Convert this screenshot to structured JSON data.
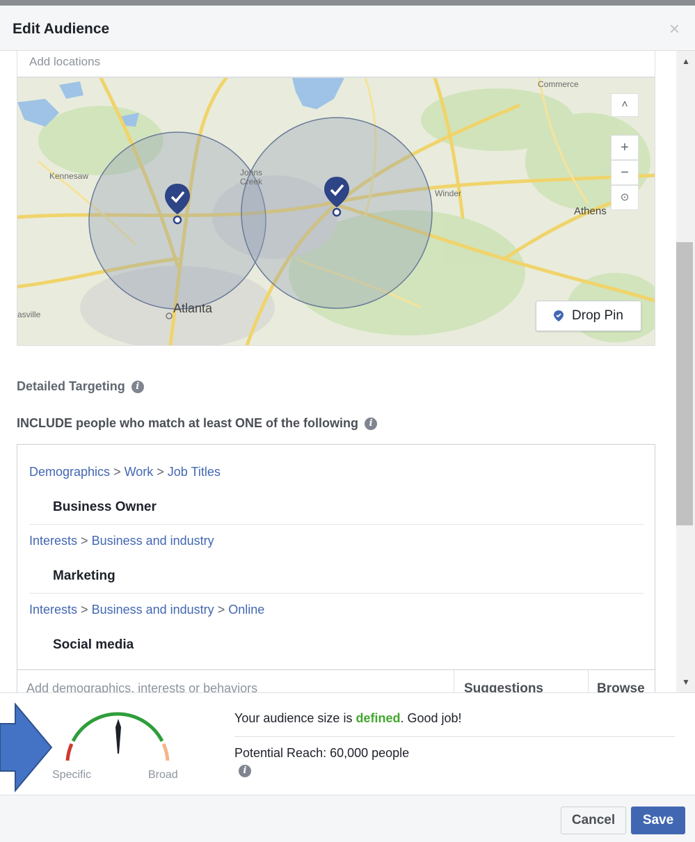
{
  "dialog": {
    "title": "Edit Audience",
    "close_icon": "×"
  },
  "locations": {
    "placeholder": "Add locations",
    "map_labels": {
      "kennesaw": "Kennesaw",
      "johns_creek_1": "Johns",
      "johns_creek_2": "Creek",
      "winder": "Winder",
      "athens": "Athens",
      "commerce": "Commerce",
      "atlanta": "Atlanta",
      "asville": "asville"
    },
    "drop_pin_label": "Drop Pin",
    "zoom_in": "+",
    "zoom_out": "−",
    "collapse": "˄"
  },
  "detailed_targeting": {
    "label": "Detailed Targeting",
    "include_label": "INCLUDE people who match at least ONE of the following",
    "groups": [
      {
        "path": [
          "Demographics",
          "Work",
          "Job Titles"
        ],
        "item": "Business Owner"
      },
      {
        "path": [
          "Interests",
          "Business and industry"
        ],
        "item": "Marketing"
      },
      {
        "path": [
          "Interests",
          "Business and industry",
          "Online"
        ],
        "item": "Social media"
      }
    ],
    "path_separator": ">",
    "input_placeholder": "Add demographics, interests or behaviors",
    "suggestions_label": "Suggestions",
    "browse_label": "Browse"
  },
  "audience": {
    "gauge_specific": "Specific",
    "gauge_broad": "Broad",
    "size_prefix": "Your audience size is ",
    "size_status": "defined",
    "size_suffix": ". Good job!",
    "reach": "Potential Reach: 60,000 people"
  },
  "actions": {
    "cancel": "Cancel",
    "save": "Save"
  },
  "colors": {
    "accent": "#4267b2",
    "pin": "#2d4486",
    "good": "#42a82e",
    "gauge_red": "#d0392b",
    "gauge_green": "#2e9e3a",
    "gauge_orange": "#f4b48a",
    "arrow": "#4472c4"
  }
}
